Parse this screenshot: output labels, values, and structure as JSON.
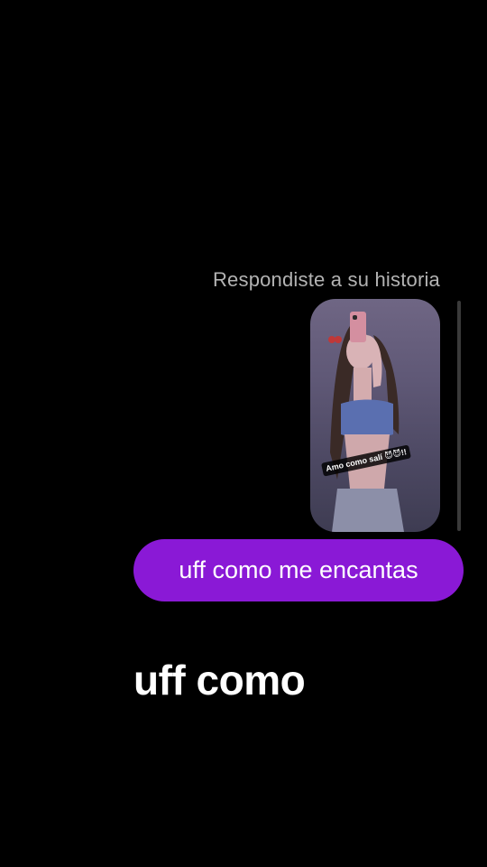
{
  "chat": {
    "reply_label": "Respondiste a su historia",
    "story": {
      "caption_text": "Amo como salí",
      "caption_emoji": "😈😈!!"
    },
    "message": {
      "text": "uff como me encantas",
      "bubble_color": "#8a19d6"
    }
  },
  "video_overlay": {
    "caption": "uff como"
  }
}
